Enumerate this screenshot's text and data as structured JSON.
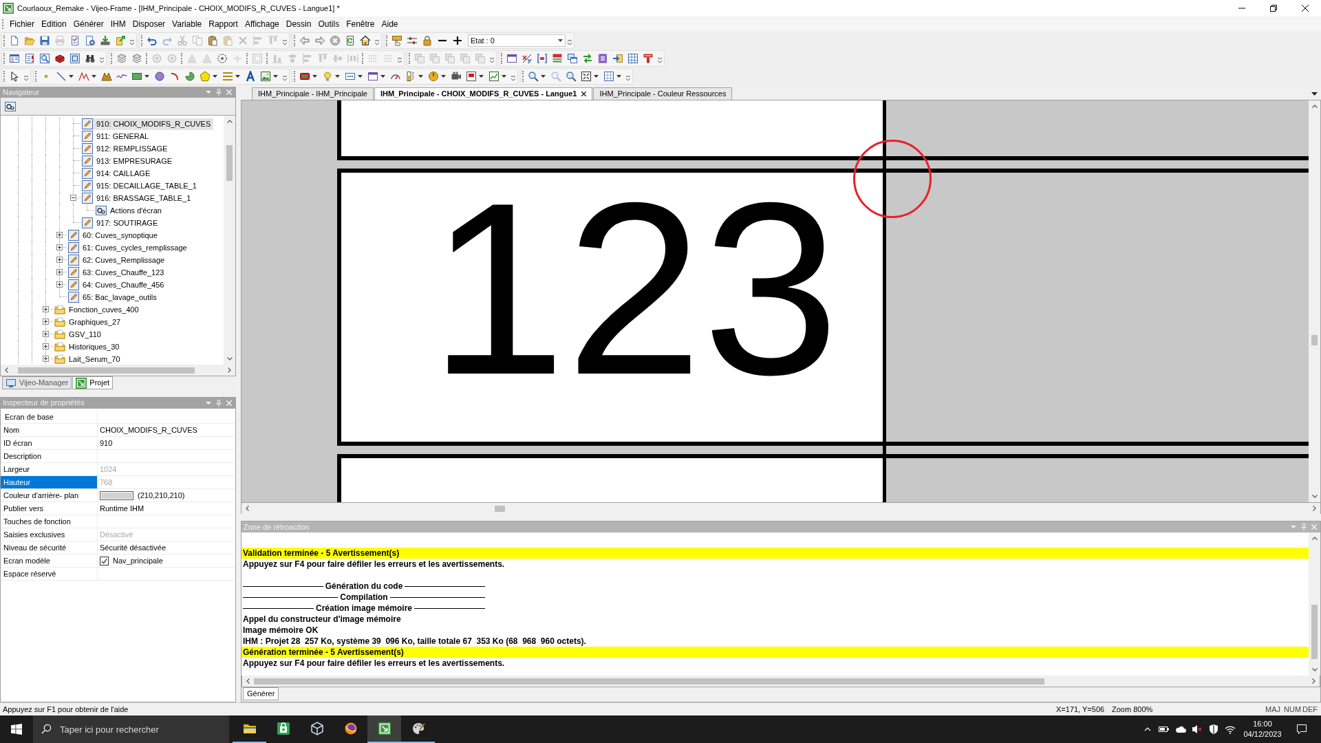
{
  "window": {
    "title": "Courlaoux_Remake - Vijeo-Frame - [IHM_Principale - CHOIX_MODIFS_R_CUVES - Langue1] *"
  },
  "menu": [
    "Fichier",
    "Edition",
    "Générer",
    "IHM",
    "Disposer",
    "Variable",
    "Rapport",
    "Affichage",
    "Dessin",
    "Outils",
    "Fenêtre",
    "Aide"
  ],
  "toolbar": {
    "state_field": {
      "value": "Etat : 0"
    }
  },
  "navigator": {
    "title": "Navigateur",
    "tree": [
      {
        "children": [
          {
            "children": [
              {
                "label": "910: CHOIX_MODIFS_R_CUVES",
                "kind": "screen",
                "selected": true
              },
              {
                "label": "911: GENERAL",
                "kind": "screen",
                "selected": false
              },
              {
                "label": "912: REMPLISSAGE",
                "kind": "screen",
                "selected": false
              },
              {
                "label": "913: EMPRESURAGE",
                "kind": "screen",
                "selected": false
              },
              {
                "label": "914: CAILLAGE",
                "kind": "screen",
                "selected": false
              },
              {
                "label": "915: DECAILLAGE_TABLE_1",
                "kind": "screen",
                "selected": false
              },
              {
                "label": "916: BRASSAGE_TABLE_1",
                "kind": "screen",
                "selected": false,
                "expanded": true,
                "children": [
                  {
                    "label": "Actions d'écran",
                    "kind": "actions",
                    "selected": false
                  }
                ]
              },
              {
                "label": "917: SOUTIRAGE",
                "kind": "screen",
                "selected": false
              }
            ]
          },
          {
            "label": "60: Cuves_synoptique",
            "kind": "screen",
            "selected": false,
            "expanded": false
          },
          {
            "label": "61: Cuves_cycles_remplissage",
            "kind": "screen",
            "selected": false,
            "expanded": false
          },
          {
            "label": "62: Cuves_Remplissage",
            "kind": "screen",
            "selected": false,
            "expanded": false
          },
          {
            "label": "63: Cuves_Chauffe_123",
            "kind": "screen",
            "selected": false,
            "expanded": false
          },
          {
            "label": "64: Cuves_Chauffe_456",
            "kind": "screen",
            "selected": false,
            "expanded": false
          },
          {
            "label": "65: Bac_lavage_outils",
            "kind": "screen",
            "selected": false
          }
        ]
      },
      {
        "label": "Fonction_cuves_400",
        "kind": "folder",
        "selected": false,
        "expanded": false
      },
      {
        "label": "Graphiques_27",
        "kind": "folder",
        "selected": false,
        "expanded": false
      },
      {
        "label": "GSV_110",
        "kind": "folder",
        "selected": false,
        "expanded": false
      },
      {
        "label": "Historiques_30",
        "kind": "folder",
        "selected": false,
        "expanded": false
      },
      {
        "label": "Lait_Serum_70",
        "kind": "folder",
        "selected": false,
        "expanded": false
      }
    ],
    "tabs": [
      {
        "label": "Vijeo-Manager",
        "kind": "manager",
        "selected": false
      },
      {
        "label": "Projet",
        "kind": "project",
        "selected": true
      }
    ]
  },
  "inspector": {
    "title": "Inspecteur de propriétés",
    "rows": [
      {
        "kind": "header",
        "label": "Ecran de base",
        "selected": false
      },
      {
        "kind": "text",
        "label": "Nom",
        "value": "CHOIX_MODIFS_R_CUVES",
        "disabled": false,
        "selected": false
      },
      {
        "kind": "text",
        "label": "ID écran",
        "value": "910",
        "disabled": false,
        "selected": false
      },
      {
        "kind": "text",
        "label": "Description",
        "selected": false
      },
      {
        "kind": "text",
        "label": "Largeur",
        "value": "1024",
        "disabled": true,
        "selected": false
      },
      {
        "kind": "text",
        "label": "Hauteur",
        "value": "768",
        "disabled": true,
        "selected": true
      },
      {
        "kind": "color",
        "label": "Couleur d'arrière- plan",
        "color": "#d2d2d2",
        "value": "(210,210,210)",
        "selected": false
      },
      {
        "kind": "text",
        "label": "Publier vers",
        "value": "Runtime IHM",
        "disabled": false,
        "selected": false
      },
      {
        "kind": "text",
        "label": "Touches de fonction",
        "selected": false
      },
      {
        "kind": "text",
        "label": "Saisies exclusives",
        "value": "Désactivé",
        "disabled": true,
        "selected": false
      },
      {
        "kind": "text",
        "label": "Niveau de sécurité",
        "value": "Sécurité désactivée",
        "disabled": false,
        "selected": false
      },
      {
        "kind": "checkbox",
        "label": "Ecran modèle",
        "checked": true,
        "value": "Nav_principale",
        "selected": false
      },
      {
        "kind": "text",
        "label": "Espace réservé",
        "selected": false
      }
    ]
  },
  "document_tabs": [
    {
      "label": "IHM_Principale - IHM_Principale",
      "selected": false
    },
    {
      "label": "IHM_Principale - CHOIX_MODIFS_R_CUVES - Langue1",
      "selected": true
    },
    {
      "label": "IHM_Principale - Couleur Ressources",
      "selected": false
    }
  ],
  "canvas": {
    "objects": [
      {
        "kind": "frame"
      },
      {
        "kind": "frame",
        "text": "123"
      },
      {
        "kind": "frame"
      }
    ]
  },
  "feedback": {
    "title": "Zone de rétroaction",
    "lines": [
      {
        "kind": "blank"
      },
      {
        "kind": "highlight",
        "text": "Validation terminée - 5 Avertissement(s)"
      },
      {
        "kind": "plain",
        "text": "Appuyez sur F4 pour faire défiler les erreurs et les avertissements."
      },
      {
        "kind": "blank"
      },
      {
        "kind": "section",
        "text": "Génération du code"
      },
      {
        "kind": "section",
        "text": "Compilation"
      },
      {
        "kind": "section",
        "text": "Création image mémoire"
      },
      {
        "kind": "plain",
        "text": "Appel du constructeur d'image mémoire"
      },
      {
        "kind": "plain",
        "text": "Image mémoire OK"
      },
      {
        "kind": "plain",
        "text": "IHM : Projet 28  257 Ko, système 39  096 Ko, taille totale 67  353 Ko (68  968  960 octets)."
      },
      {
        "kind": "highlight",
        "text": "Génération terminée - 5 Avertissement(s)"
      },
      {
        "kind": "plain",
        "text": "Appuyez sur F4 pour faire défiler les erreurs et les avertissements."
      }
    ],
    "tabs": [
      {
        "label": "Générer",
        "selected": true
      }
    ]
  },
  "status_bar": {
    "help": "Appuyez sur F1 pour obtenir de l'aide",
    "coordinates": "X=171, Y=506",
    "zoom": "Zoom 800%",
    "indicators": [
      "MAJ",
      "NUM",
      "DEF"
    ]
  },
  "taskbar": {
    "search": {
      "placeholder": "Taper ici pour rechercher"
    },
    "apps": [
      {
        "kind": "files",
        "open": true,
        "selected": false
      },
      {
        "kind": "tile",
        "open": false,
        "selected": false
      },
      {
        "kind": "cube",
        "open": false,
        "selected": false
      },
      {
        "kind": "globe",
        "open": false,
        "selected": false
      },
      {
        "kind": "designer",
        "open": true,
        "selected": true
      },
      {
        "kind": "palette",
        "open": true,
        "selected": false
      }
    ],
    "clock": {
      "time": "16:00",
      "date": "04/12/2023"
    }
  }
}
